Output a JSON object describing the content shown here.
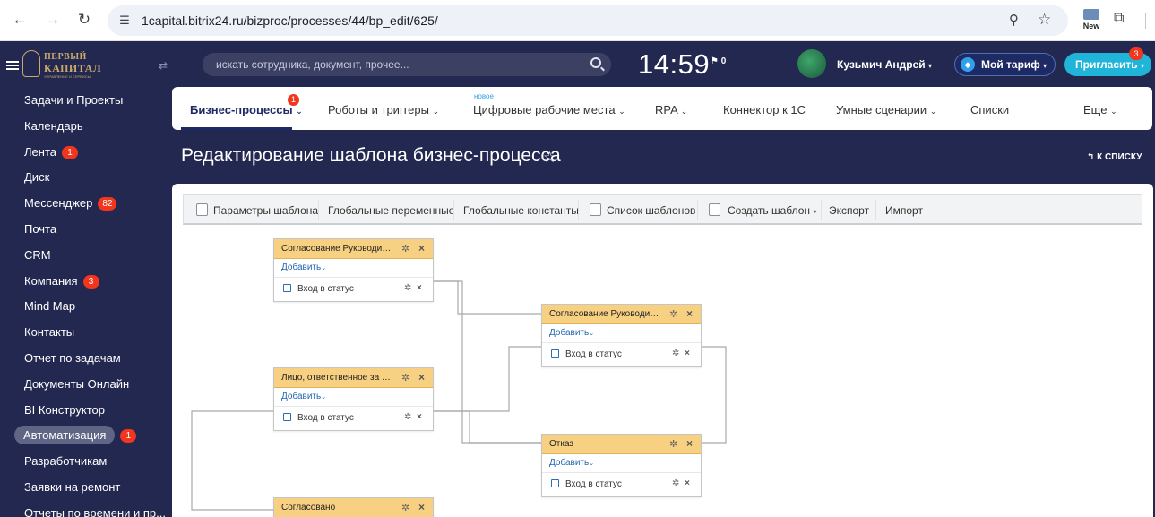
{
  "browser": {
    "url": "1capital.bitrix24.ru/bizproc/processes/44/bp_edit/625/",
    "extension_label": "New"
  },
  "sidebar": {
    "logo": {
      "line1": "ПЕРВЫЙ",
      "line2": "КАПИТАЛ",
      "line3": "УПРАВЛЕНИЕ И СЕРВИСЫ"
    },
    "items": [
      {
        "label": "Задачи и Проекты"
      },
      {
        "label": "Календарь"
      },
      {
        "label": "Лента",
        "badge": "1"
      },
      {
        "label": "Диск"
      },
      {
        "label": "Мессенджер",
        "badge": "82"
      },
      {
        "label": "Почта"
      },
      {
        "label": "CRM"
      },
      {
        "label": "Компания",
        "badge": "3"
      },
      {
        "label": "Mind Map"
      },
      {
        "label": "Контакты"
      },
      {
        "label": "Отчет по задачам"
      },
      {
        "label": "Документы Онлайн"
      },
      {
        "label": "BI Конструктор"
      },
      {
        "label": "Автоматизация",
        "badge": "1",
        "active": true
      },
      {
        "label": "Разработчикам"
      },
      {
        "label": "Заявки на ремонт"
      },
      {
        "label": "Отчеты по времени и пр..."
      }
    ]
  },
  "header": {
    "search_placeholder": "искать сотрудника, документ, прочее...",
    "time": "14:59",
    "flag_count": "0",
    "user_name": "Кузьмич Андрей",
    "plan_label": "Мой тариф",
    "invite_label": "Пригласить",
    "invite_count": "3"
  },
  "nav": {
    "items": [
      {
        "label": "Бизнес-процессы",
        "badge": "1"
      },
      {
        "label": "Роботы и триггеры"
      },
      {
        "label": "Цифровые рабочие места",
        "tag": "новое"
      },
      {
        "label": "RPA"
      },
      {
        "label": "Коннектор к 1С"
      },
      {
        "label": "Умные сценарии"
      },
      {
        "label": "Списки"
      },
      {
        "label": "Еще"
      }
    ]
  },
  "page": {
    "title": "Редактирование шаблона бизнес-процесса",
    "back_label": "К СПИСКУ"
  },
  "toolbar": {
    "params": "Параметры шаблона",
    "global_vars": "Глобальные переменные",
    "global_consts": "Глобальные константы",
    "template_list": "Список шаблонов",
    "create_template": "Создать шаблон",
    "export": "Экспорт",
    "import": "Импорт"
  },
  "blocks": [
    {
      "title": "Согласование Руководите...",
      "add": "Добавить",
      "row": "Вход в статус"
    },
    {
      "title": "Лицо, ответственное за за...",
      "add": "Добавить",
      "row": "Вход в статус"
    },
    {
      "title": "Согласовано"
    },
    {
      "title": "Согласование Руководите...",
      "add": "Добавить",
      "row": "Вход в статус"
    },
    {
      "title": "Отказ",
      "add": "Добавить",
      "row": "Вход в статус"
    }
  ]
}
